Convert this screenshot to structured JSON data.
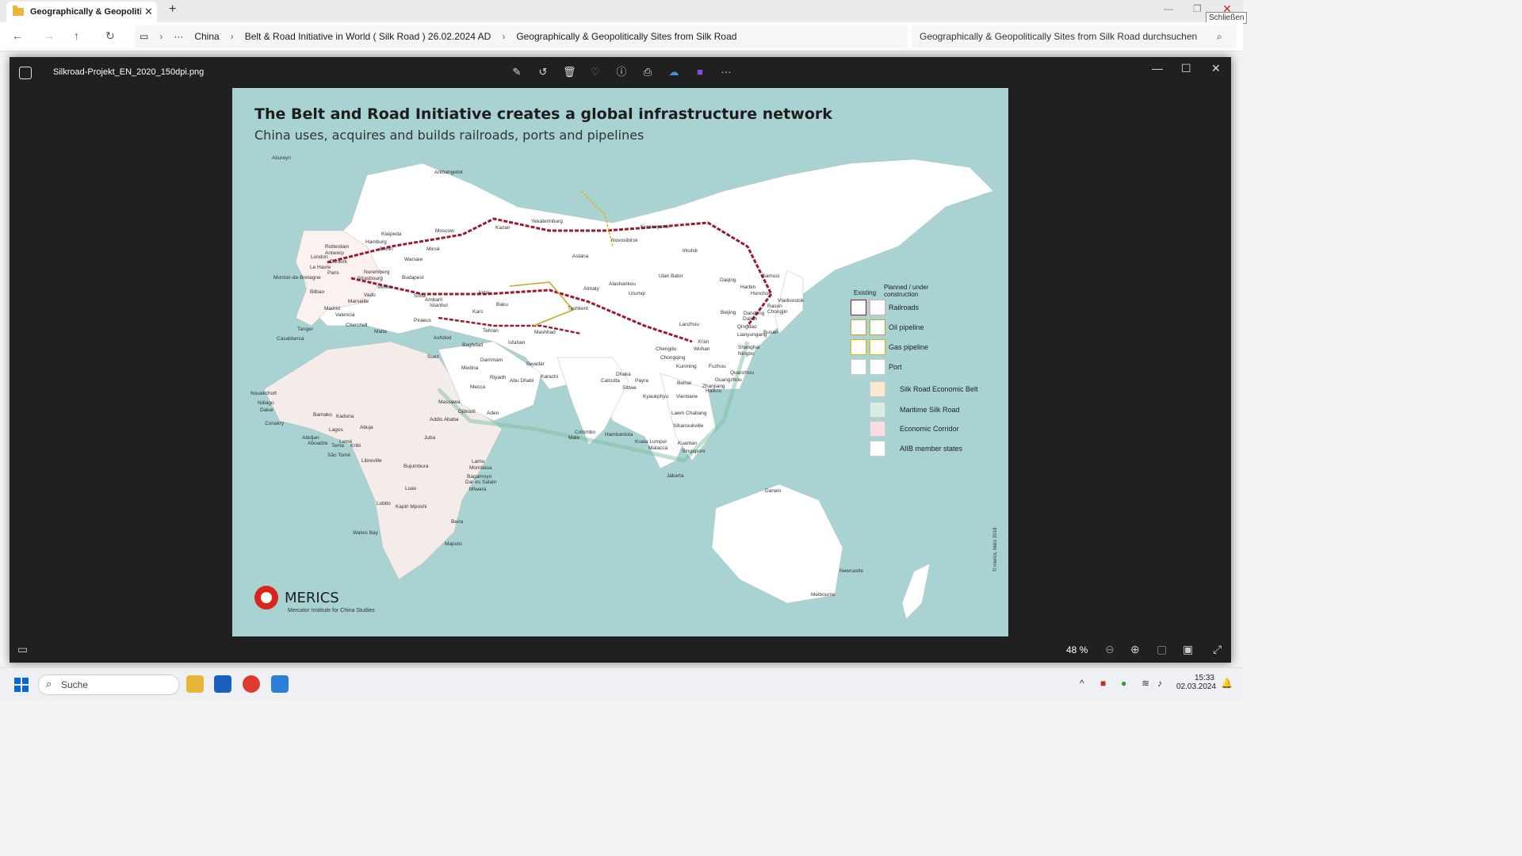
{
  "explorer": {
    "tab_title": "Geographically & Geopoliticall",
    "tab_close": "✕",
    "new_tab": "+",
    "close_tooltip": "Schließen",
    "breadcrumbs": [
      "China",
      "Belt & Road Initiative in World ( Silk Road ) 26.02.2024 AD",
      "Geographically & Geopolitically Sites from Silk Road"
    ],
    "search_placeholder": "Geographically & Geopolitically Sites from Silk Road durchsuchen",
    "ellipsis": "···"
  },
  "viewer": {
    "filename": "Silkroad-Projekt_EN_2020_150dpi.png",
    "zoom": "48 %",
    "tools": [
      "edit-icon",
      "rotate-icon",
      "delete-icon",
      "favorite-icon",
      "info-icon",
      "print-icon",
      "onedrive-icon",
      "clipchamp-icon",
      "more-icon"
    ]
  },
  "map": {
    "title": "The Belt and Road Initiative creates a global infrastructure network",
    "subtitle": "China uses, acquires and builds railroads, ports and pipelines",
    "legend": {
      "existing": "Existing",
      "planned": "Planned / under construction",
      "items": [
        "Railroads",
        "Oil pipeline",
        "Gas pipeline",
        "Port",
        "Silk Road Economic Belt",
        "Maritime Silk Road",
        "Economic Corridor",
        "AIIB member states"
      ]
    },
    "logo_name": "MERICS",
    "logo_sub": "Mercator Institute for China Studies",
    "copyright": "© merics, März 2018",
    "cities": [
      "Akureyri",
      "Arkhangelsk",
      "Rotterdam",
      "Antwerp",
      "London",
      "Dunkirk",
      "Le Havre",
      "Paris",
      "Montoir-de-Bretagne",
      "Bilbao",
      "Madrid",
      "Valencia",
      "Tanger",
      "Casablanca",
      "Cherchell",
      "Marseille",
      "Vado",
      "Venice",
      "Malta",
      "Piraeus",
      "Ambarli",
      "Istanbul",
      "Kazan",
      "Yekaterinburg",
      "Moscow",
      "Minsk",
      "Warsaw",
      "Hamburg",
      "Berlin",
      "Klaipeda",
      "Budapest",
      "Sofia",
      "Nuremberg",
      "Strasbourg",
      "Novosibirsk",
      "Krasnoyarsk",
      "Irkutsk",
      "Ulan Bator",
      "Astana",
      "Almaty",
      "Urumqi",
      "Alashankou",
      "Aktau",
      "Baku",
      "Tehran",
      "Mashhad",
      "Tashkent",
      "Kars",
      "Baghdad",
      "Ashdod",
      "Suez",
      "Medina",
      "Mecca",
      "Dammam",
      "Riyadh",
      "Abu Dhabi",
      "Gwadar",
      "Karachi",
      "Isfahan",
      "Djibouti",
      "Aden",
      "Massawa",
      "Addis Ababa",
      "Juba",
      "Kaduna",
      "Abuja",
      "Bamako",
      "Lagos",
      "Lomé",
      "Abidjan",
      "Aboadze",
      "Kribi",
      "Tema",
      "Dakar",
      "Ndiago",
      "Nouakchott",
      "Conakry",
      "São Tomé",
      "Libreville",
      "Lobito",
      "Luau",
      "Kapiri Mposhi",
      "Bujumbura",
      "Lamu",
      "Mombasa",
      "Bagamoyo",
      "Dar es Salam",
      "Mtwara",
      "Beira",
      "Maputo",
      "Walvis Bay",
      "Kunming",
      "Chengdu",
      "Chongqing",
      "Lanzhou",
      "Xi'an",
      "Wuhan",
      "Shanghai",
      "Ningbo",
      "Fuzhou",
      "Quanzhou",
      "Guangzhou",
      "Zhanjiang",
      "Haikou",
      "Beihai",
      "Dalian",
      "Qingdao",
      "Lianyungang",
      "Dandong",
      "Harbin",
      "Daqing",
      "Jiamusi",
      "Hunchun",
      "Rason",
      "Chongjin",
      "Vladivostok",
      "Busan",
      "Beijing",
      "Dhaka",
      "Calcutta",
      "Payra",
      "Sittwe",
      "Kyaukphyu",
      "Vientiane",
      "Laem Chabang",
      "Sihanoukville",
      "Kuala Lumpur",
      "Malacca",
      "Kuantan",
      "Singapore",
      "Jakarta",
      "Colombo",
      "Hambantota",
      "Male",
      "Darwin",
      "Newcastle",
      "Melbourne"
    ]
  },
  "taskbar": {
    "search_label": "Suche",
    "time": "15:33",
    "date": "02.03.2024"
  },
  "colors": {
    "sea": "#a9d3d3",
    "land": "#ffffff",
    "rail": "#9b1b2e",
    "oil": "#c9a227",
    "gas": "#e3b400"
  }
}
